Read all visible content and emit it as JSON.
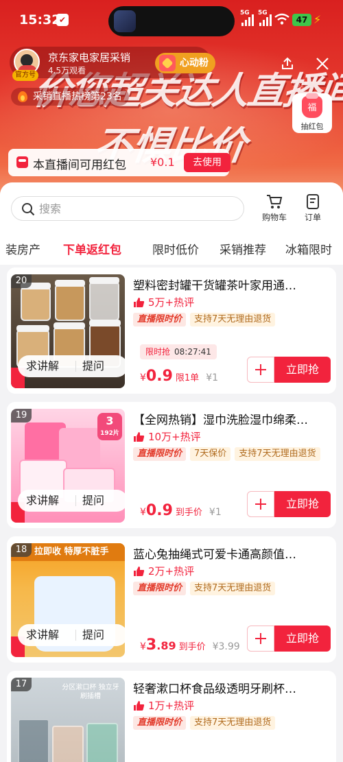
{
  "status_bar": {
    "time": "15:32",
    "signal_1": "5G",
    "signal_2": "5G",
    "battery": "47"
  },
  "live": {
    "host_name": "京东家电家居采销",
    "views": "4.5万观看",
    "official_tag": "官方号",
    "follow_label": "心动粉",
    "rank_text": "采销直播热榜第23名",
    "room_id": "1921",
    "banner_line1": "价您超关达人直播间",
    "banner_line2": "不惧比价",
    "lucky_bag_label": "抽红包",
    "lucky_bag_char": "福",
    "coupon_text": "本直播间可用红包",
    "coupon_amount": "¥0.1",
    "coupon_button": "去使用"
  },
  "sheet": {
    "search_placeholder": "搜索",
    "cart_label": "购物车",
    "orders_label": "订单",
    "tabs": [
      "装房产",
      "下单返红包",
      "限时低价",
      "采销推荐",
      "冰箱限时"
    ],
    "active_tab": "下单返红包"
  },
  "colors": {
    "brand": "#f2233d",
    "banner": "#e53a2e"
  },
  "actions": {
    "explain": "求讲解",
    "ask": "提问",
    "buy": "立即抢"
  },
  "products": [
    {
      "rank": "20",
      "title": "塑料密封罐干货罐茶叶家用通…",
      "hot": "5万+热评",
      "live_tag": "直播限时价",
      "tags": [
        "支持7天无理由退货"
      ],
      "flash_label": "限时抢",
      "flash_time": "08:27:41",
      "price_int": "0",
      "price_dec": ".9",
      "price_note": "限1单",
      "price_orig": "¥1"
    },
    {
      "rank": "19",
      "title": "【全网热销】湿巾洗脸湿巾绵柔…",
      "hot": "10万+热评",
      "live_tag": "直播限时价",
      "tags": [
        "7天保价",
        "支持7天无理由退货"
      ],
      "image_badge": "3",
      "image_badge_sub": "192片",
      "price_int": "0",
      "price_dec": ".9",
      "price_note": "到手价",
      "price_orig": "¥1"
    },
    {
      "rank": "18",
      "title": "蓝心兔抽绳式可爱卡通高颜值…",
      "hot": "2万+热评",
      "live_tag": "直播限时价",
      "tags": [
        "支持7天无理由退货"
      ],
      "image_banner": "拉即收 特厚不脏手",
      "price_int": "3",
      "price_dec": ".89",
      "price_note": "到手价",
      "price_orig": "¥3.99"
    },
    {
      "rank": "17",
      "title": "轻奢漱口杯食品级透明牙刷杯…",
      "hot": "1万+热评",
      "live_tag": "直播限时价",
      "tags": [
        "支持7天无理由退货"
      ],
      "image_caption": "分区漱口杯 独立牙刷插槽"
    }
  ]
}
